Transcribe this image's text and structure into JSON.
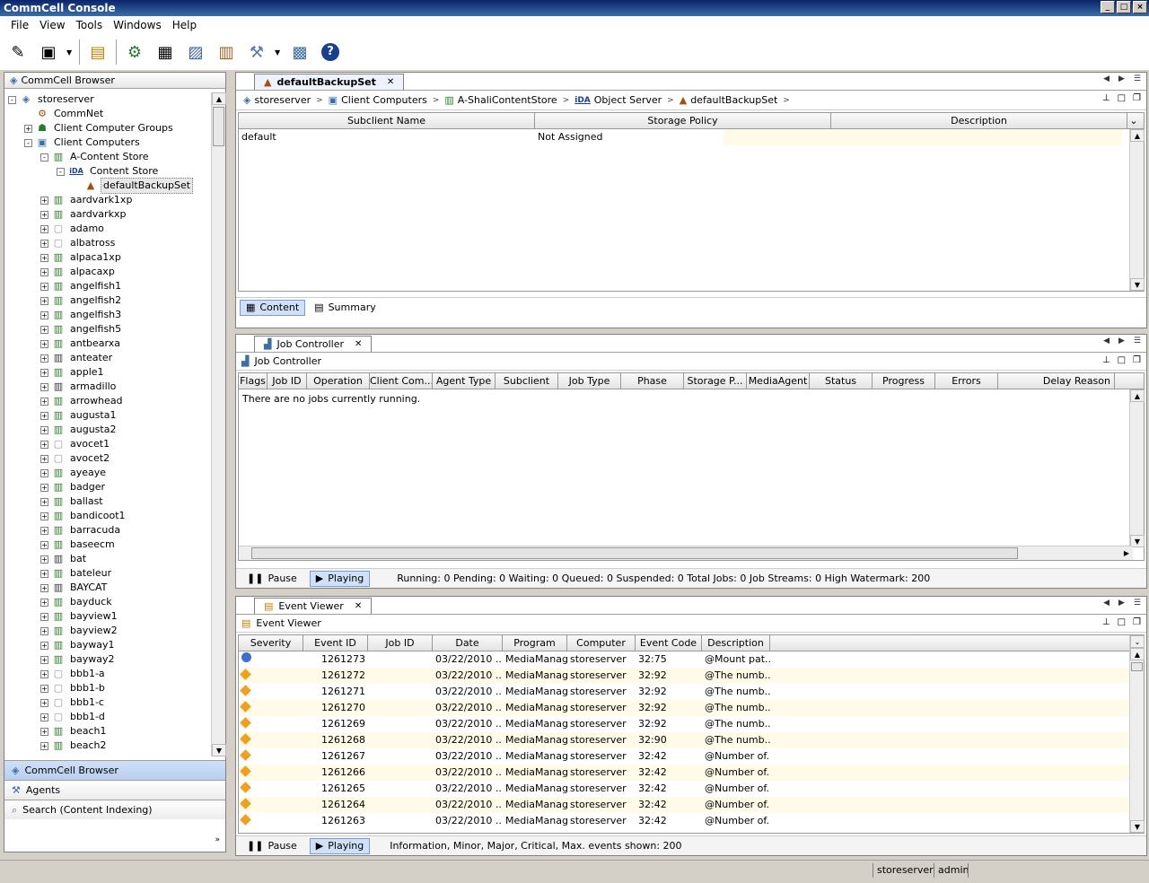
{
  "window": {
    "title": "CommCell Console"
  },
  "menu": [
    "File",
    "View",
    "Tools",
    "Windows",
    "Help"
  ],
  "toolbar": {
    "icons": [
      "edit-icon",
      "media-icon",
      "schedule-icon",
      "network-icon",
      "table-icon",
      "save-icon",
      "report-icon",
      "tools-icon",
      "monitor-icon",
      "help-icon"
    ]
  },
  "left": {
    "header": "CommCell Browser",
    "tree": [
      {
        "label": "storeserver",
        "level": 0,
        "toggle": "-",
        "icon": "server-icon"
      },
      {
        "label": "CommNet",
        "level": 1,
        "toggle": "",
        "icon": "network-icon"
      },
      {
        "label": "Client Computer Groups",
        "level": 1,
        "toggle": "+",
        "icon": "group-icon"
      },
      {
        "label": "Client Computers",
        "level": 1,
        "toggle": "-",
        "icon": "computers-icon"
      },
      {
        "label": "A-Content Store",
        "level": 2,
        "toggle": "-",
        "icon": "client-icon"
      },
      {
        "label": "Content Store",
        "level": 3,
        "toggle": "-",
        "icon": "ida-icon"
      },
      {
        "label": "defaultBackupSet",
        "level": 4,
        "toggle": "",
        "icon": "backupset-icon",
        "selected": true
      },
      {
        "label": "aardvark1xp",
        "level": 2,
        "toggle": "+",
        "icon": "client-icon"
      },
      {
        "label": "aardvarkxp",
        "level": 2,
        "toggle": "+",
        "icon": "client-icon"
      },
      {
        "label": "adamo",
        "level": 2,
        "toggle": "+",
        "icon": "client-gray-icon"
      },
      {
        "label": "albatross",
        "level": 2,
        "toggle": "+",
        "icon": "client-gray-icon"
      },
      {
        "label": "alpaca1xp",
        "level": 2,
        "toggle": "+",
        "icon": "client-icon"
      },
      {
        "label": "alpacaxp",
        "level": 2,
        "toggle": "+",
        "icon": "client-icon"
      },
      {
        "label": "angelfish1",
        "level": 2,
        "toggle": "+",
        "icon": "client-icon"
      },
      {
        "label": "angelfish2",
        "level": 2,
        "toggle": "+",
        "icon": "client-icon"
      },
      {
        "label": "angelfish3",
        "level": 2,
        "toggle": "+",
        "icon": "client-icon"
      },
      {
        "label": "angelfish5",
        "level": 2,
        "toggle": "+",
        "icon": "client-icon"
      },
      {
        "label": "antbearxa",
        "level": 2,
        "toggle": "+",
        "icon": "client-icon"
      },
      {
        "label": "anteater",
        "level": 2,
        "toggle": "+",
        "icon": "client-dark-icon"
      },
      {
        "label": "apple1",
        "level": 2,
        "toggle": "+",
        "icon": "client-icon"
      },
      {
        "label": "armadillo",
        "level": 2,
        "toggle": "+",
        "icon": "client-dark-icon"
      },
      {
        "label": "arrowhead",
        "level": 2,
        "toggle": "+",
        "icon": "client-icon"
      },
      {
        "label": "augusta1",
        "level": 2,
        "toggle": "+",
        "icon": "client-icon"
      },
      {
        "label": "augusta2",
        "level": 2,
        "toggle": "+",
        "icon": "client-icon"
      },
      {
        "label": "avocet1",
        "level": 2,
        "toggle": "+",
        "icon": "client-gray-icon"
      },
      {
        "label": "avocet2",
        "level": 2,
        "toggle": "+",
        "icon": "client-gray-icon"
      },
      {
        "label": "ayeaye",
        "level": 2,
        "toggle": "+",
        "icon": "client-icon"
      },
      {
        "label": "badger",
        "level": 2,
        "toggle": "+",
        "icon": "client-icon"
      },
      {
        "label": "ballast",
        "level": 2,
        "toggle": "+",
        "icon": "client-icon"
      },
      {
        "label": "bandicoot1",
        "level": 2,
        "toggle": "+",
        "icon": "client-icon"
      },
      {
        "label": "barracuda",
        "level": 2,
        "toggle": "+",
        "icon": "client-icon"
      },
      {
        "label": "baseecm",
        "level": 2,
        "toggle": "+",
        "icon": "client-icon"
      },
      {
        "label": "bat",
        "level": 2,
        "toggle": "+",
        "icon": "client-dark-icon"
      },
      {
        "label": "bateleur",
        "level": 2,
        "toggle": "+",
        "icon": "client-icon"
      },
      {
        "label": "BAYCAT",
        "level": 2,
        "toggle": "+",
        "icon": "client-dark-icon"
      },
      {
        "label": "bayduck",
        "level": 2,
        "toggle": "+",
        "icon": "client-icon"
      },
      {
        "label": "bayview1",
        "level": 2,
        "toggle": "+",
        "icon": "client-icon"
      },
      {
        "label": "bayview2",
        "level": 2,
        "toggle": "+",
        "icon": "client-icon"
      },
      {
        "label": "bayway1",
        "level": 2,
        "toggle": "+",
        "icon": "client-icon"
      },
      {
        "label": "bayway2",
        "level": 2,
        "toggle": "+",
        "icon": "client-icon"
      },
      {
        "label": "bbb1-a",
        "level": 2,
        "toggle": "+",
        "icon": "client-gray-icon"
      },
      {
        "label": "bbb1-b",
        "level": 2,
        "toggle": "+",
        "icon": "client-gray-icon"
      },
      {
        "label": "bbb1-c",
        "level": 2,
        "toggle": "+",
        "icon": "client-gray-icon"
      },
      {
        "label": "bbb1-d",
        "level": 2,
        "toggle": "+",
        "icon": "client-gray-icon"
      },
      {
        "label": "beach1",
        "level": 2,
        "toggle": "+",
        "icon": "client-icon"
      },
      {
        "label": "beach2",
        "level": 2,
        "toggle": "+",
        "icon": "client-icon"
      }
    ],
    "nav": [
      {
        "label": "CommCell Browser",
        "active": true,
        "icon": "browser-icon"
      },
      {
        "label": "Agents",
        "active": false,
        "icon": "agents-icon"
      },
      {
        "label": "Search (Content Indexing)",
        "active": false,
        "icon": "search-icon"
      }
    ]
  },
  "backupset_pane": {
    "tab": "defaultBackupSet",
    "breadcrumb": [
      "storeserver",
      "Client Computers",
      "A-ShaliContentStore",
      "Object Server",
      "defaultBackupSet"
    ],
    "columns": [
      "Subclient Name",
      "Storage Policy",
      "Description"
    ],
    "rows": [
      {
        "name": "default",
        "policy": "Not Assigned",
        "desc": ""
      }
    ],
    "bottom_tabs": [
      "Content",
      "Summary"
    ]
  },
  "job_pane": {
    "tab": "Job Controller",
    "sub_title": "Job Controller",
    "columns": [
      "Flags",
      "Job ID",
      "Operation",
      "Client Com...",
      "Agent Type",
      "Subclient",
      "Job Type",
      "Phase",
      "Storage P...",
      "MediaAgent",
      "Status",
      "Progress",
      "Errors",
      "Delay Reason"
    ],
    "empty_message": "There are no jobs currently running.",
    "pause_label": "Pause",
    "playing_label": "Playing",
    "status_text": "Running: 0 Pending: 0 Waiting: 0 Queued: 0 Suspended: 0 Total Jobs: 0 Job Streams: 0 High Watermark: 200"
  },
  "event_pane": {
    "tab": "Event Viewer",
    "sub_title": "Event Viewer",
    "columns": [
      "Severity",
      "Event ID",
      "Job ID",
      "Date",
      "Program",
      "Computer",
      "Event Code",
      "Description"
    ],
    "rows": [
      {
        "sev": "info",
        "id": "1261273",
        "job": "",
        "date": "03/22/2010 ...",
        "program": "MediaManager",
        "computer": "storeserver",
        "code": "32:75",
        "desc": "@Mount pat..."
      },
      {
        "sev": "minor",
        "id": "1261272",
        "job": "",
        "date": "03/22/2010 ...",
        "program": "MediaManager",
        "computer": "storeserver",
        "code": "32:92",
        "desc": "@The numb..."
      },
      {
        "sev": "minor",
        "id": "1261271",
        "job": "",
        "date": "03/22/2010 ...",
        "program": "MediaManager",
        "computer": "storeserver",
        "code": "32:92",
        "desc": "@The numb..."
      },
      {
        "sev": "minor",
        "id": "1261270",
        "job": "",
        "date": "03/22/2010 ...",
        "program": "MediaManager",
        "computer": "storeserver",
        "code": "32:92",
        "desc": "@The numb..."
      },
      {
        "sev": "minor",
        "id": "1261269",
        "job": "",
        "date": "03/22/2010 ...",
        "program": "MediaManager",
        "computer": "storeserver",
        "code": "32:92",
        "desc": "@The numb..."
      },
      {
        "sev": "minor",
        "id": "1261268",
        "job": "",
        "date": "03/22/2010 ...",
        "program": "MediaManager",
        "computer": "storeserver",
        "code": "32:90",
        "desc": "@The numb..."
      },
      {
        "sev": "minor",
        "id": "1261267",
        "job": "",
        "date": "03/22/2010 ...",
        "program": "MediaManager",
        "computer": "storeserver",
        "code": "32:42",
        "desc": "@Number of..."
      },
      {
        "sev": "minor",
        "id": "1261266",
        "job": "",
        "date": "03/22/2010 ...",
        "program": "MediaManager",
        "computer": "storeserver",
        "code": "32:42",
        "desc": "@Number of..."
      },
      {
        "sev": "minor",
        "id": "1261265",
        "job": "",
        "date": "03/22/2010 ...",
        "program": "MediaManager",
        "computer": "storeserver",
        "code": "32:42",
        "desc": "@Number of..."
      },
      {
        "sev": "minor",
        "id": "1261264",
        "job": "",
        "date": "03/22/2010 ...",
        "program": "MediaManager",
        "computer": "storeserver",
        "code": "32:42",
        "desc": "@Number of..."
      },
      {
        "sev": "minor",
        "id": "1261263",
        "job": "",
        "date": "03/22/2010 ...",
        "program": "MediaManager",
        "computer": "storeserver",
        "code": "32:42",
        "desc": "@Number of..."
      }
    ],
    "pause_label": "Pause",
    "playing_label": "Playing",
    "status_text": "Information, Minor, Major, Critical, Max. events shown: 200"
  },
  "status": {
    "server": "storeserver",
    "user": "admin"
  }
}
